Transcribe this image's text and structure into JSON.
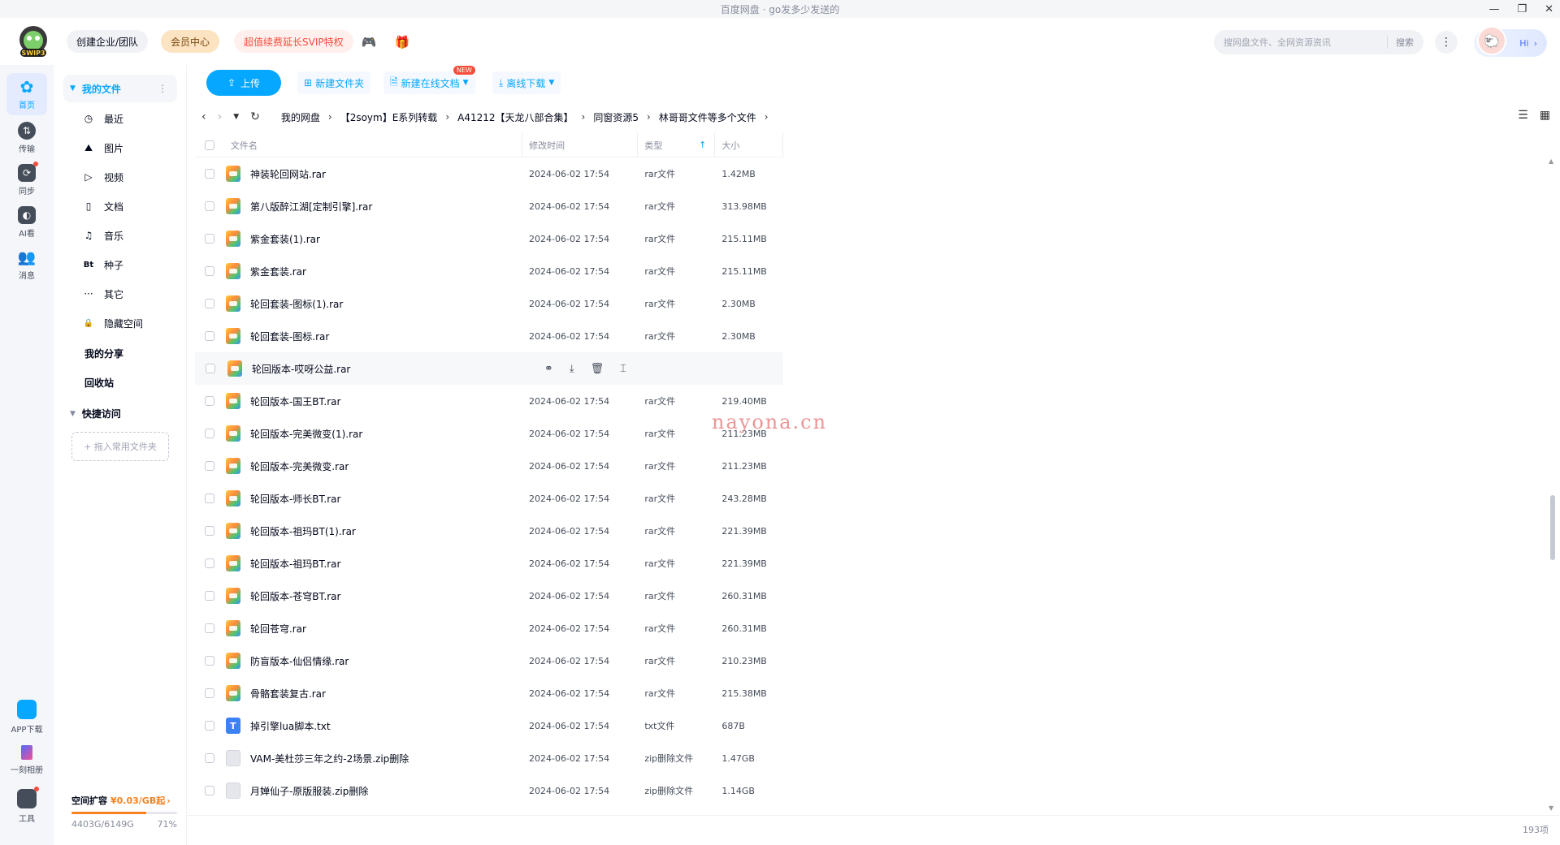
{
  "window": {
    "title": "百度网盘 · go发多少发送的"
  },
  "header": {
    "logo_badge": "SWIP3",
    "team_label": "创建企业/团队",
    "vip_label": "会员中心",
    "svip_label": "超值续费延长SVIP特权",
    "search_placeholder": "搜网盘文件、全网资源资讯",
    "search_button": "搜索",
    "hi_label": "Hi"
  },
  "rail": [
    {
      "label": "首页",
      "icon": "home-icon"
    },
    {
      "label": "传输",
      "icon": "transfer-icon"
    },
    {
      "label": "同步",
      "icon": "sync-icon"
    },
    {
      "label": "AI看",
      "icon": "ai-icon"
    },
    {
      "label": "消息",
      "icon": "message-icon"
    }
  ],
  "rail_bottom": [
    {
      "label": "APP下载"
    },
    {
      "label": "一刻相册"
    },
    {
      "label": "工具"
    }
  ],
  "sidebar": {
    "my_files": "我的文件",
    "sub_items": [
      {
        "label": "最近",
        "glyph": "◷"
      },
      {
        "label": "图片",
        "glyph": "⛰"
      },
      {
        "label": "视频",
        "glyph": "▷"
      },
      {
        "label": "文档",
        "glyph": "▯"
      },
      {
        "label": "音乐",
        "glyph": "♫"
      },
      {
        "label": "种子",
        "glyph": "Bt"
      },
      {
        "label": "其它",
        "glyph": "···"
      },
      {
        "label": "隐藏空间",
        "glyph": "🔒"
      }
    ],
    "my_share": "我的分享",
    "recycle": "回收站",
    "quick_access": "快捷访问",
    "drop_hint": "+ 拖入常用文件夹",
    "space": {
      "title": "空间扩容",
      "price": "¥0.03/GB起",
      "used_text": "4403G/6149G",
      "percent_text": "71%",
      "percent": 71
    }
  },
  "toolbar": {
    "upload": "上传",
    "new_folder": "新建文件夹",
    "new_doc": "新建在线文档",
    "new_badge": "NEW",
    "offline": "离线下载"
  },
  "breadcrumb": [
    "我的网盘",
    "【2soym】E系列转载",
    "A41212【天龙八部合集】",
    "同窗资源5",
    "林哥哥文件等多个文件"
  ],
  "table": {
    "headers": {
      "name": "文件名",
      "modified": "修改时间",
      "type": "类型",
      "size": "大小"
    },
    "rows": [
      {
        "name": "神装轮回网站.rar",
        "time": "2024-06-02 17:54",
        "type": "rar文件",
        "size": "1.42MB",
        "kind": "rar"
      },
      {
        "name": "第八版醉江湖[定制引擎].rar",
        "time": "2024-06-02 17:54",
        "type": "rar文件",
        "size": "313.98MB",
        "kind": "rar"
      },
      {
        "name": "紫金套装(1).rar",
        "time": "2024-06-02 17:54",
        "type": "rar文件",
        "size": "215.11MB",
        "kind": "rar"
      },
      {
        "name": "紫金套装.rar",
        "time": "2024-06-02 17:54",
        "type": "rar文件",
        "size": "215.11MB",
        "kind": "rar"
      },
      {
        "name": "轮回套装-图标(1).rar",
        "time": "2024-06-02 17:54",
        "type": "rar文件",
        "size": "2.30MB",
        "kind": "rar"
      },
      {
        "name": "轮回套装-图标.rar",
        "time": "2024-06-02 17:54",
        "type": "rar文件",
        "size": "2.30MB",
        "kind": "rar"
      },
      {
        "name": "轮回版本-哎呀公益.rar",
        "time": "",
        "type": "",
        "size": "",
        "kind": "rar",
        "hover": true
      },
      {
        "name": "轮回版本-国王BT.rar",
        "time": "2024-06-02 17:54",
        "type": "rar文件",
        "size": "219.40MB",
        "kind": "rar"
      },
      {
        "name": "轮回版本-完美微变(1).rar",
        "time": "2024-06-02 17:54",
        "type": "rar文件",
        "size": "211.23MB",
        "kind": "rar"
      },
      {
        "name": "轮回版本-完美微变.rar",
        "time": "2024-06-02 17:54",
        "type": "rar文件",
        "size": "211.23MB",
        "kind": "rar"
      },
      {
        "name": "轮回版本-师长BT.rar",
        "time": "2024-06-02 17:54",
        "type": "rar文件",
        "size": "243.28MB",
        "kind": "rar"
      },
      {
        "name": "轮回版本-祖玛BT(1).rar",
        "time": "2024-06-02 17:54",
        "type": "rar文件",
        "size": "221.39MB",
        "kind": "rar"
      },
      {
        "name": "轮回版本-祖玛BT.rar",
        "time": "2024-06-02 17:54",
        "type": "rar文件",
        "size": "221.39MB",
        "kind": "rar"
      },
      {
        "name": "轮回版本-苍穹BT.rar",
        "time": "2024-06-02 17:54",
        "type": "rar文件",
        "size": "260.31MB",
        "kind": "rar"
      },
      {
        "name": "轮回苍穹.rar",
        "time": "2024-06-02 17:54",
        "type": "rar文件",
        "size": "260.31MB",
        "kind": "rar"
      },
      {
        "name": "防盲版本-仙侣情缘.rar",
        "time": "2024-06-02 17:54",
        "type": "rar文件",
        "size": "210.23MB",
        "kind": "rar"
      },
      {
        "name": "骨骼套装复古.rar",
        "time": "2024-06-02 17:54",
        "type": "rar文件",
        "size": "215.38MB",
        "kind": "rar"
      },
      {
        "name": "掉引擎lua脚本.txt",
        "time": "2024-06-02 17:54",
        "type": "txt文件",
        "size": "687B",
        "kind": "txt"
      },
      {
        "name": "VAM-美杜莎三年之约-2场景.zip删除",
        "time": "2024-06-02 17:54",
        "type": "zip删除文件",
        "size": "1.47GB",
        "kind": "zip"
      },
      {
        "name": "月婵仙子-原版服装.zip删除",
        "time": "2024-06-02 17:54",
        "type": "zip删除文件",
        "size": "1.14GB",
        "kind": "zip"
      }
    ]
  },
  "watermark": "nayona.cn",
  "item_count": "193项"
}
